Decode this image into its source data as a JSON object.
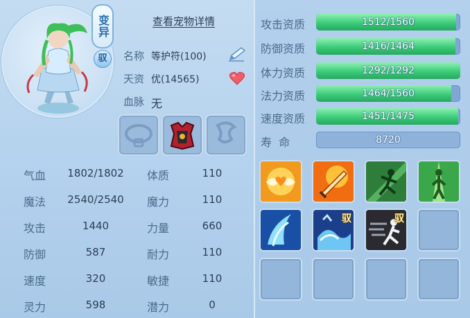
{
  "pet": {
    "mutation_badge": "变异",
    "tame_badge": "驭",
    "detail_link": "查看宠物详情",
    "name_label": "名称",
    "name_value": "等护符(100)",
    "talent_label": "天资",
    "talent_value": "优(14565)",
    "bloodline_label": "血脉",
    "bloodline_value": "无"
  },
  "stats": [
    {
      "label": "气血",
      "value": "1802/1802",
      "attr_label": "体质",
      "attr_value": "110"
    },
    {
      "label": "魔法",
      "value": "2540/2540",
      "attr_label": "魔力",
      "attr_value": "110"
    },
    {
      "label": "攻击",
      "value": "1440",
      "attr_label": "力量",
      "attr_value": "660"
    },
    {
      "label": "防御",
      "value": "587",
      "attr_label": "耐力",
      "attr_value": "110"
    },
    {
      "label": "速度",
      "value": "320",
      "attr_label": "敏捷",
      "attr_value": "110"
    },
    {
      "label": "灵力",
      "value": "598",
      "attr_label": "潜力",
      "attr_value": "0"
    }
  ],
  "aptitudes": [
    {
      "label": "攻击资质",
      "text": "1512/1560",
      "current": 1512,
      "max": 1560
    },
    {
      "label": "防御资质",
      "text": "1416/1464",
      "current": 1416,
      "max": 1464
    },
    {
      "label": "体力资质",
      "text": "1292/1292",
      "current": 1292,
      "max": 1292
    },
    {
      "label": "法力资质",
      "text": "1464/1560",
      "current": 1464,
      "max": 1560
    },
    {
      "label": "速度资质",
      "text": "1451/1475",
      "current": 1451,
      "max": 1475
    }
  ],
  "lifespan": {
    "label": "寿  命",
    "value": "8720"
  },
  "skills": [
    {
      "icon": "heart-wings-skill-icon",
      "badge": ""
    },
    {
      "icon": "flaming-sword-skill-icon",
      "badge": ""
    },
    {
      "icon": "shadow-strike-skill-icon",
      "badge": ""
    },
    {
      "icon": "green-aura-skill-icon",
      "badge": ""
    },
    {
      "icon": "water-wave-skill-icon",
      "badge": ""
    },
    {
      "icon": "water-splash-skill-icon",
      "badge": "驭"
    },
    {
      "icon": "dash-skill-icon",
      "badge": "驭"
    }
  ],
  "colors": {
    "bar_fill": "#3ccc7a",
    "bar_bg": "#7fa6d4",
    "label": "#4a6b8c",
    "text": "#2c3e55"
  }
}
